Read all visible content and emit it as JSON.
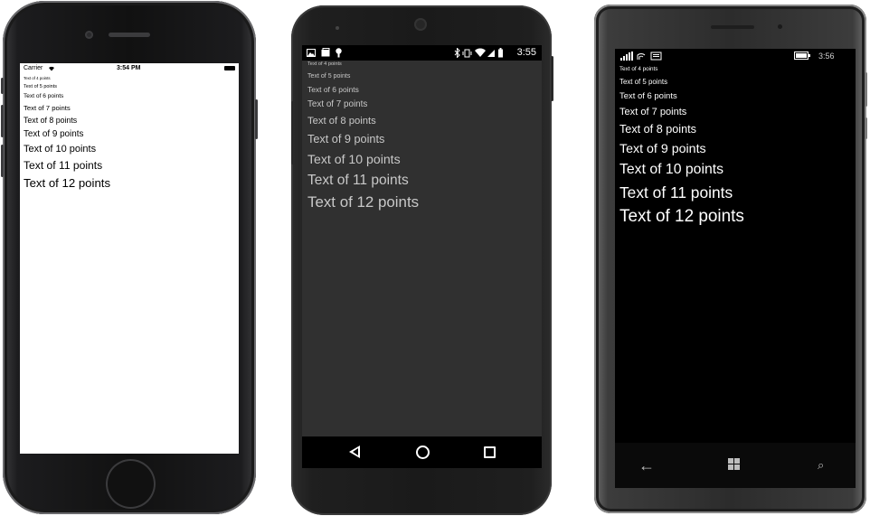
{
  "ios": {
    "status": {
      "carrier": "Carrier",
      "wifi_icon": "wifi-icon",
      "time": "3:54 PM",
      "battery_icon": "battery-icon"
    },
    "lines": [
      {
        "text": "Text of 4 points",
        "pt": 4
      },
      {
        "text": "Text of 5 points",
        "pt": 5
      },
      {
        "text": "Text of 6 points",
        "pt": 6
      },
      {
        "text": "Text of 7 points",
        "pt": 7
      },
      {
        "text": "Text of 8 points",
        "pt": 8
      },
      {
        "text": "Text of 9 points",
        "pt": 9
      },
      {
        "text": "Text of 10 points",
        "pt": 10
      },
      {
        "text": "Text of 11 points",
        "pt": 11
      },
      {
        "text": "Text of 12 points",
        "pt": 12
      }
    ],
    "colors": {
      "background": "#ffffff",
      "text": "#000000"
    }
  },
  "android": {
    "status": {
      "time": "3:55",
      "notification_icons": [
        "image-icon",
        "photo-icon",
        "bulb-icon"
      ],
      "system_icons": [
        "bluetooth-icon",
        "vibrate-icon",
        "wifi-icon",
        "signal-icon",
        "battery-icon"
      ]
    },
    "lines": [
      {
        "text": "Text of 4 points",
        "pt": 4
      },
      {
        "text": "Text of 5 points",
        "pt": 5
      },
      {
        "text": "Text of 6 points",
        "pt": 6
      },
      {
        "text": "Text of 7 points",
        "pt": 7
      },
      {
        "text": "Text of 8 points",
        "pt": 8
      },
      {
        "text": "Text of 9 points",
        "pt": 9
      },
      {
        "text": "Text of 10 points",
        "pt": 10
      },
      {
        "text": "Text of 11 points",
        "pt": 11
      },
      {
        "text": "Text of 12 points",
        "pt": 12
      }
    ],
    "nav": {
      "back_icon": "back-triangle-icon",
      "home_icon": "home-circle-icon",
      "recents_icon": "recents-square-icon"
    },
    "colors": {
      "background": "#303030",
      "text": "#c8c8c8",
      "status_bar": "#000000"
    }
  },
  "winphone": {
    "status": {
      "time": "3:56",
      "signal_icon": "signal-bars-icon",
      "battery_icon": "battery-icon"
    },
    "lines": [
      {
        "text": "Text of 4 points",
        "pt": 4
      },
      {
        "text": "Text of 5 points",
        "pt": 5
      },
      {
        "text": "Text of 6 points",
        "pt": 6
      },
      {
        "text": "Text of 7 points",
        "pt": 7
      },
      {
        "text": "Text of 8 points",
        "pt": 8
      },
      {
        "text": "Text of 9 points",
        "pt": 9
      },
      {
        "text": "Text of 10 points",
        "pt": 10
      },
      {
        "text": "Text of 11 points",
        "pt": 11
      },
      {
        "text": "Text of 12 points",
        "pt": 12
      }
    ],
    "nav": {
      "back_icon": "back-arrow-icon",
      "start_icon": "windows-logo-icon",
      "search_icon": "search-icon"
    },
    "colors": {
      "background": "#000000",
      "text": "#ffffff"
    }
  }
}
